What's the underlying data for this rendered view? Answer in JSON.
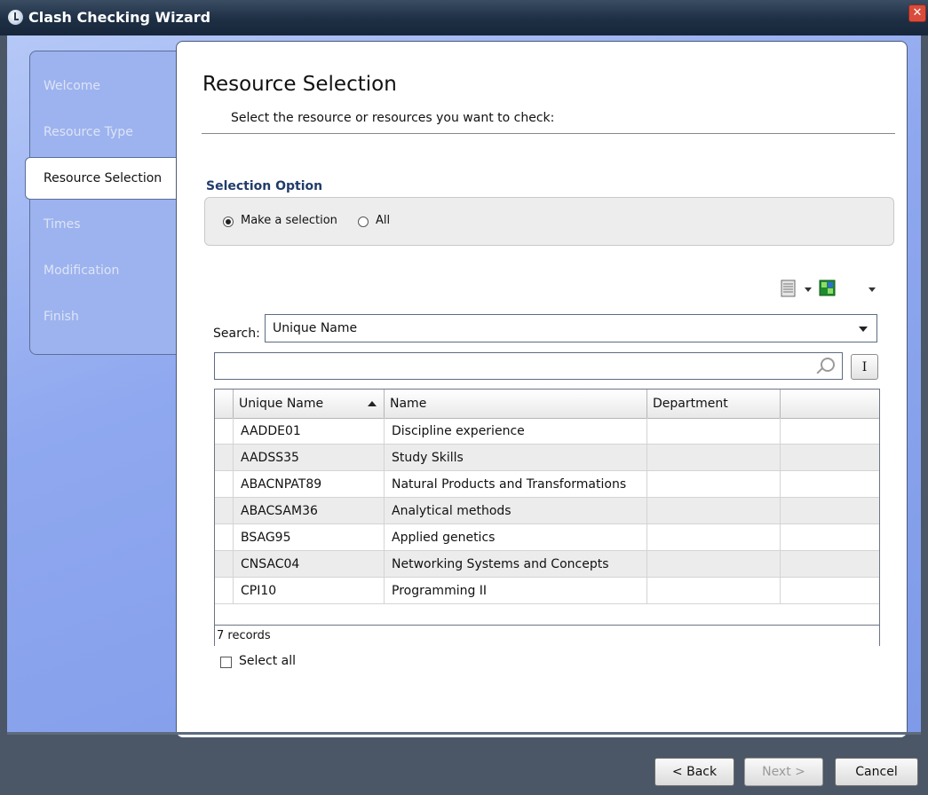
{
  "window": {
    "title": "Clash Checking Wizard",
    "close_glyph": "✕"
  },
  "sidebar": {
    "items": [
      {
        "label": "Welcome"
      },
      {
        "label": "Resource Type"
      },
      {
        "label": "Resource Selection"
      },
      {
        "label": "Times"
      },
      {
        "label": "Modification"
      },
      {
        "label": "Finish"
      }
    ],
    "active_index": 2
  },
  "page": {
    "title": "Resource Selection",
    "subtitle": "Select the resource or resources you want to check:"
  },
  "selection": {
    "heading": "Selection Option",
    "options": [
      "Make a selection",
      "All"
    ],
    "selected": "Make a selection"
  },
  "toolbar": {
    "icons": [
      "columns-icon",
      "export-icon"
    ]
  },
  "search": {
    "label": "Search:",
    "field": "Unique Name",
    "query": "",
    "clear_button": "I"
  },
  "grid": {
    "columns": [
      "Unique Name",
      "Name",
      "Department"
    ],
    "sorted_column": "Unique Name",
    "sort_direction": "ascending",
    "rows": [
      {
        "unique_name": "AADDE01",
        "name": "Discipline experience",
        "department": ""
      },
      {
        "unique_name": "AADSS35",
        "name": "Study Skills",
        "department": ""
      },
      {
        "unique_name": "ABACNPAT89",
        "name": "Natural Products and Transformations",
        "department": ""
      },
      {
        "unique_name": "ABACSAM36",
        "name": "Analytical methods",
        "department": ""
      },
      {
        "unique_name": "BSAG95",
        "name": "Applied genetics",
        "department": ""
      },
      {
        "unique_name": "CNSAC04",
        "name": "Networking Systems and Concepts",
        "department": ""
      },
      {
        "unique_name": "CPI10",
        "name": "Programming II",
        "department": ""
      }
    ],
    "record_count": "7 records"
  },
  "select_all": {
    "label": "Select all",
    "checked": false
  },
  "buttons": {
    "back": "< Back",
    "next": "Next >",
    "cancel": "Cancel"
  },
  "colors": {
    "title_bar": "#1e2f44",
    "sidebar": "#9db3ef",
    "heading": "#213c6b"
  }
}
